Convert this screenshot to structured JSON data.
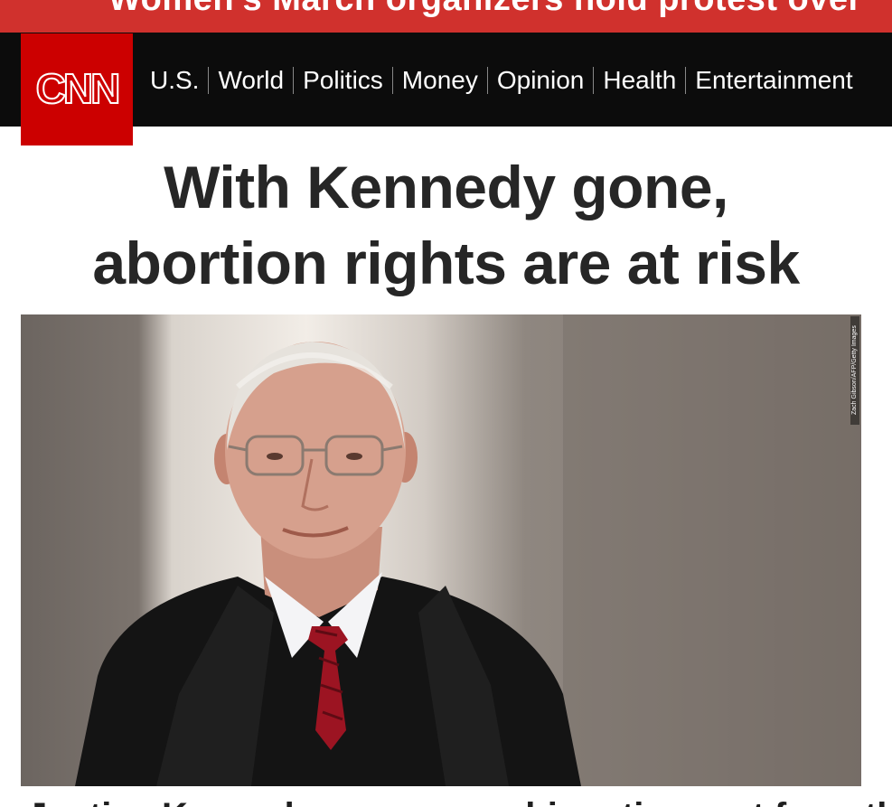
{
  "breaking": {
    "text": "Women's March organizers hold protest over"
  },
  "logo": {
    "text": "CNN"
  },
  "nav": {
    "items": [
      {
        "label": "U.S."
      },
      {
        "label": "World"
      },
      {
        "label": "Politics"
      },
      {
        "label": "Money"
      },
      {
        "label": "Opinion"
      },
      {
        "label": "Health"
      },
      {
        "label": "Entertainment"
      }
    ]
  },
  "article": {
    "headline_line1": "With Kennedy gone,",
    "headline_line2": "abortion rights are at risk",
    "image_credit": "Zach Gibson/AFP/Getty Images",
    "next_line": "Justice Kennedy announces his retirement from the"
  },
  "colors": {
    "brand_red": "#cc0000",
    "banner_red": "#d0312d",
    "nav_bg": "#0c0c0c",
    "headline_text": "#262626"
  }
}
